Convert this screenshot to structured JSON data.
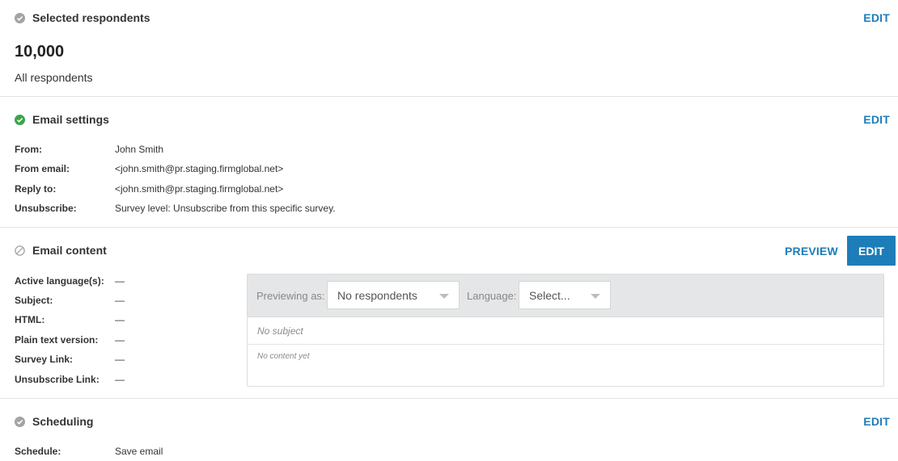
{
  "respondents": {
    "title": "Selected respondents",
    "edit_label": "EDIT",
    "count": "10,000",
    "description": "All respondents",
    "status_color": "#9e9e9e"
  },
  "email_settings": {
    "title": "Email settings",
    "edit_label": "EDIT",
    "status_color": "#3aa648",
    "rows": [
      {
        "label": "From:",
        "value": "John Smith"
      },
      {
        "label": "From email:",
        "value": "<john.smith@pr.staging.firmglobal.net>"
      },
      {
        "label": "Reply to:",
        "value": "<john.smith@pr.staging.firmglobal.net>"
      },
      {
        "label": "Unsubscribe:",
        "value": "Survey level: Unsubscribe from this specific survey."
      }
    ]
  },
  "email_content": {
    "title": "Email content",
    "preview_label": "PREVIEW",
    "edit_label": "EDIT",
    "rows": [
      {
        "label": "Active language(s):",
        "value": "—"
      },
      {
        "label": "Subject:",
        "value": "—"
      },
      {
        "label": "HTML:",
        "value": "—"
      },
      {
        "label": "Plain text version:",
        "value": "—"
      },
      {
        "label": "Survey Link:",
        "value": "—"
      },
      {
        "label": "Unsubscribe Link:",
        "value": "—"
      }
    ],
    "preview": {
      "previewing_as_label": "Previewing as:",
      "respondent_select": "No respondents",
      "language_label": "Language:",
      "language_select": "Select...",
      "subject": "No subject",
      "content": "No content yet"
    }
  },
  "scheduling": {
    "title": "Scheduling",
    "edit_label": "EDIT",
    "status_color": "#9e9e9e",
    "rows": [
      {
        "label": "Schedule:",
        "value": "Save email"
      }
    ]
  },
  "accent_color": "#1d7db9"
}
